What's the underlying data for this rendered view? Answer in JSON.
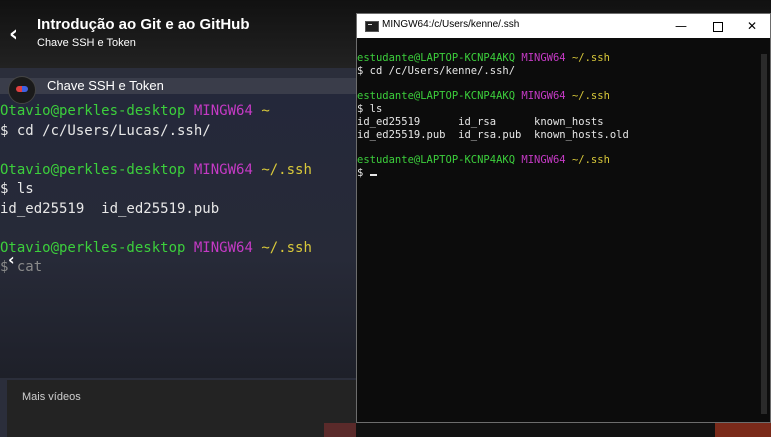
{
  "video": {
    "course_title": "Introdução ao Git e ao GitHub",
    "course_subtitle": "Chave SSH e Token",
    "channel_title": "Chave SSH e Token",
    "more_videos_label": "Mais vídeos",
    "terminal_lines": [
      {
        "user": "Otavio@perkles-desktop",
        "env": "MINGW64",
        "path": "~"
      },
      {
        "cmd": "$ cd /c/Users/Lucas/.ssh/"
      },
      {
        "user": "Otavio@perkles-desktop",
        "env": "MINGW64",
        "path": "~/.ssh"
      },
      {
        "cmd": "$ ls"
      },
      {
        "out": "id_ed25519  id_ed25519.pub"
      },
      {
        "user": "Otavio@perkles-desktop",
        "env": "MINGW64",
        "path": "~/.ssh"
      },
      {
        "cmd": "$ cat"
      }
    ]
  },
  "terminal_window": {
    "title": "MINGW64:/c/Users/kenne/.ssh",
    "minimize_glyph": "—",
    "close_glyph": "✕",
    "lines": {
      "p1_user": "estudante@LAPTOP-KCNP4AKQ",
      "p1_env": "MINGW64",
      "p1_path": "~/.ssh",
      "c1": "$ cd /c/Users/kenne/.ssh/",
      "p2_user": "estudante@LAPTOP-KCNP4AKQ",
      "p2_env": "MINGW64",
      "p2_path": "~/.ssh",
      "c2": "$ ls",
      "o1": "id_ed25519      id_rsa      known_hosts",
      "o2": "id_ed25519.pub  id_rsa.pub  known_hosts.old",
      "p3_user": "estudante@LAPTOP-KCNP4AKQ",
      "p3_env": "MINGW64",
      "p3_path": "~/.ssh",
      "c3": "$ "
    }
  },
  "colors": {
    "prompt_user": "#3ccf3c",
    "prompt_env": "#c53ac5",
    "prompt_path": "#d9c93a",
    "terminal_bg": "#0c0c0c"
  }
}
